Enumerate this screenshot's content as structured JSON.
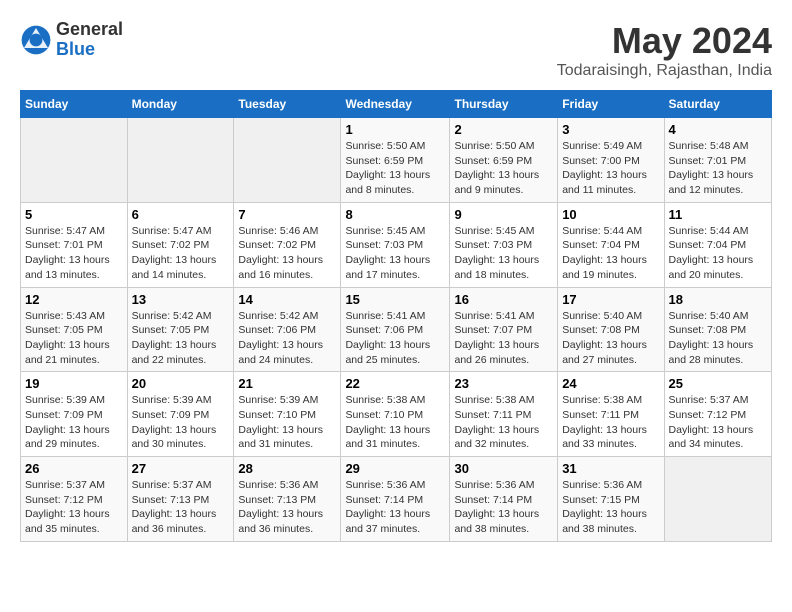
{
  "logo": {
    "general": "General",
    "blue": "Blue"
  },
  "title": "May 2024",
  "subtitle": "Todaraisingh, Rajasthan, India",
  "header_days": [
    "Sunday",
    "Monday",
    "Tuesday",
    "Wednesday",
    "Thursday",
    "Friday",
    "Saturday"
  ],
  "weeks": [
    [
      {
        "day": "",
        "info": ""
      },
      {
        "day": "",
        "info": ""
      },
      {
        "day": "",
        "info": ""
      },
      {
        "day": "1",
        "info": "Sunrise: 5:50 AM\nSunset: 6:59 PM\nDaylight: 13 hours and 8 minutes."
      },
      {
        "day": "2",
        "info": "Sunrise: 5:50 AM\nSunset: 6:59 PM\nDaylight: 13 hours and 9 minutes."
      },
      {
        "day": "3",
        "info": "Sunrise: 5:49 AM\nSunset: 7:00 PM\nDaylight: 13 hours and 11 minutes."
      },
      {
        "day": "4",
        "info": "Sunrise: 5:48 AM\nSunset: 7:01 PM\nDaylight: 13 hours and 12 minutes."
      }
    ],
    [
      {
        "day": "5",
        "info": "Sunrise: 5:47 AM\nSunset: 7:01 PM\nDaylight: 13 hours and 13 minutes."
      },
      {
        "day": "6",
        "info": "Sunrise: 5:47 AM\nSunset: 7:02 PM\nDaylight: 13 hours and 14 minutes."
      },
      {
        "day": "7",
        "info": "Sunrise: 5:46 AM\nSunset: 7:02 PM\nDaylight: 13 hours and 16 minutes."
      },
      {
        "day": "8",
        "info": "Sunrise: 5:45 AM\nSunset: 7:03 PM\nDaylight: 13 hours and 17 minutes."
      },
      {
        "day": "9",
        "info": "Sunrise: 5:45 AM\nSunset: 7:03 PM\nDaylight: 13 hours and 18 minutes."
      },
      {
        "day": "10",
        "info": "Sunrise: 5:44 AM\nSunset: 7:04 PM\nDaylight: 13 hours and 19 minutes."
      },
      {
        "day": "11",
        "info": "Sunrise: 5:44 AM\nSunset: 7:04 PM\nDaylight: 13 hours and 20 minutes."
      }
    ],
    [
      {
        "day": "12",
        "info": "Sunrise: 5:43 AM\nSunset: 7:05 PM\nDaylight: 13 hours and 21 minutes."
      },
      {
        "day": "13",
        "info": "Sunrise: 5:42 AM\nSunset: 7:05 PM\nDaylight: 13 hours and 22 minutes."
      },
      {
        "day": "14",
        "info": "Sunrise: 5:42 AM\nSunset: 7:06 PM\nDaylight: 13 hours and 24 minutes."
      },
      {
        "day": "15",
        "info": "Sunrise: 5:41 AM\nSunset: 7:06 PM\nDaylight: 13 hours and 25 minutes."
      },
      {
        "day": "16",
        "info": "Sunrise: 5:41 AM\nSunset: 7:07 PM\nDaylight: 13 hours and 26 minutes."
      },
      {
        "day": "17",
        "info": "Sunrise: 5:40 AM\nSunset: 7:08 PM\nDaylight: 13 hours and 27 minutes."
      },
      {
        "day": "18",
        "info": "Sunrise: 5:40 AM\nSunset: 7:08 PM\nDaylight: 13 hours and 28 minutes."
      }
    ],
    [
      {
        "day": "19",
        "info": "Sunrise: 5:39 AM\nSunset: 7:09 PM\nDaylight: 13 hours and 29 minutes."
      },
      {
        "day": "20",
        "info": "Sunrise: 5:39 AM\nSunset: 7:09 PM\nDaylight: 13 hours and 30 minutes."
      },
      {
        "day": "21",
        "info": "Sunrise: 5:39 AM\nSunset: 7:10 PM\nDaylight: 13 hours and 31 minutes."
      },
      {
        "day": "22",
        "info": "Sunrise: 5:38 AM\nSunset: 7:10 PM\nDaylight: 13 hours and 31 minutes."
      },
      {
        "day": "23",
        "info": "Sunrise: 5:38 AM\nSunset: 7:11 PM\nDaylight: 13 hours and 32 minutes."
      },
      {
        "day": "24",
        "info": "Sunrise: 5:38 AM\nSunset: 7:11 PM\nDaylight: 13 hours and 33 minutes."
      },
      {
        "day": "25",
        "info": "Sunrise: 5:37 AM\nSunset: 7:12 PM\nDaylight: 13 hours and 34 minutes."
      }
    ],
    [
      {
        "day": "26",
        "info": "Sunrise: 5:37 AM\nSunset: 7:12 PM\nDaylight: 13 hours and 35 minutes."
      },
      {
        "day": "27",
        "info": "Sunrise: 5:37 AM\nSunset: 7:13 PM\nDaylight: 13 hours and 36 minutes."
      },
      {
        "day": "28",
        "info": "Sunrise: 5:36 AM\nSunset: 7:13 PM\nDaylight: 13 hours and 36 minutes."
      },
      {
        "day": "29",
        "info": "Sunrise: 5:36 AM\nSunset: 7:14 PM\nDaylight: 13 hours and 37 minutes."
      },
      {
        "day": "30",
        "info": "Sunrise: 5:36 AM\nSunset: 7:14 PM\nDaylight: 13 hours and 38 minutes."
      },
      {
        "day": "31",
        "info": "Sunrise: 5:36 AM\nSunset: 7:15 PM\nDaylight: 13 hours and 38 minutes."
      },
      {
        "day": "",
        "info": ""
      }
    ]
  ]
}
